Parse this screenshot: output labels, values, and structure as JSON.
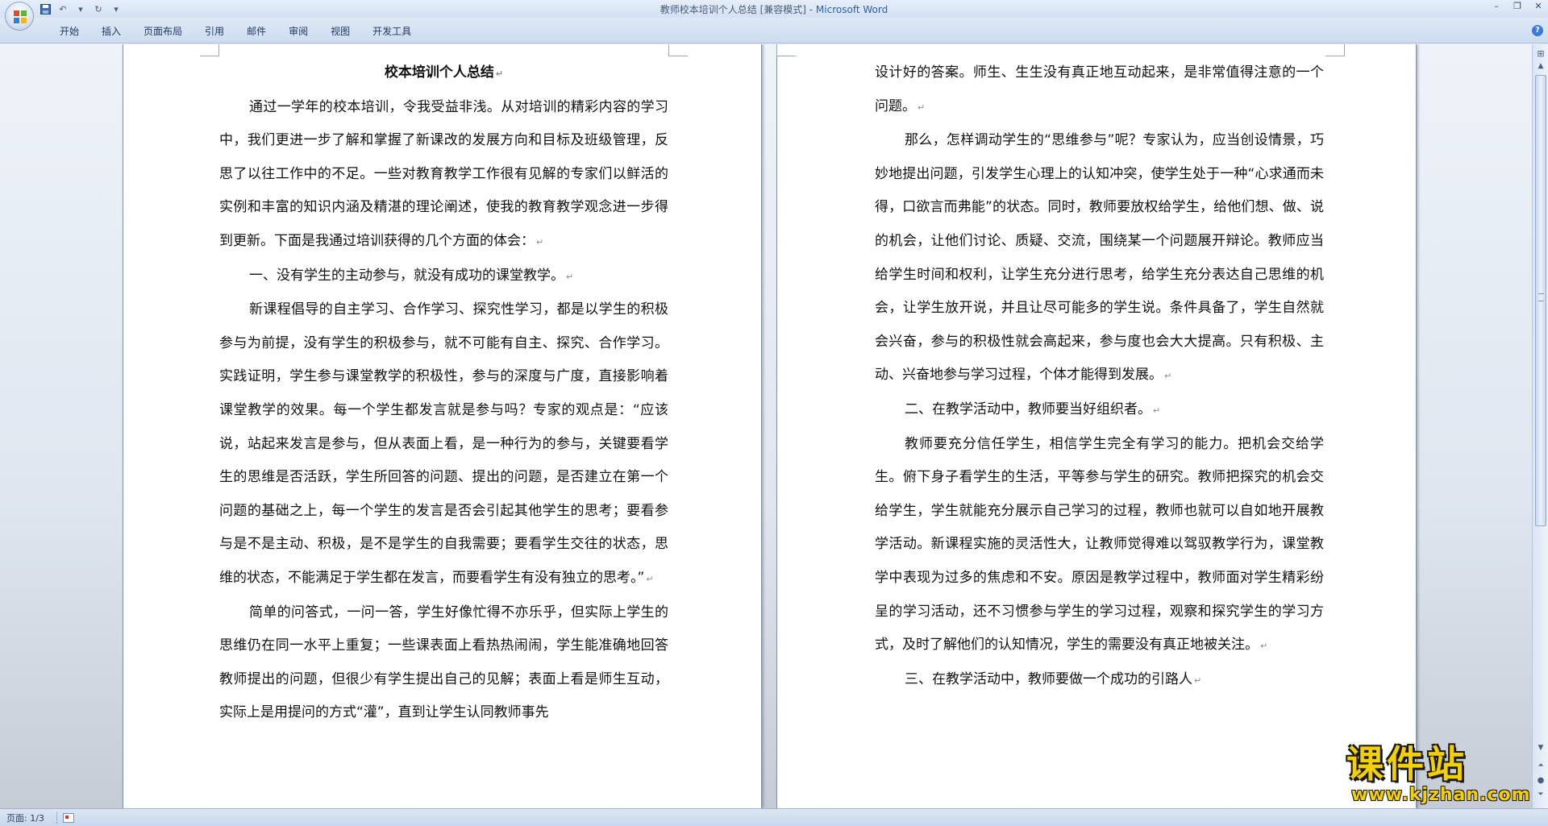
{
  "window": {
    "title_doc": "教师校本培训个人总结 [兼容模式] - ",
    "title_app": "Microsoft Word"
  },
  "ribbon": {
    "tabs": [
      "开始",
      "插入",
      "页面布局",
      "引用",
      "邮件",
      "审阅",
      "视图",
      "开发工具"
    ]
  },
  "document": {
    "title": "校本培训个人总结",
    "left_paragraphs": [
      "通过一学年的校本培训，令我受益非浅。从对培训的精彩内容的学习中，我们更进一步了解和掌握了新课改的发展方向和目标及班级管理，反思了以往工作中的不足。一些对教育教学工作很有见解的专家们以鲜活的实例和丰富的知识内涵及精湛的理论阐述，使我的教育教学观念进一步得到更新。下面是我通过培训获得的几个方面的体会：",
      "一、没有学生的主动参与，就没有成功的课堂教学。",
      "新课程倡导的自主学习、合作学习、探究性学习，都是以学生的积极参与为前提，没有学生的积极参与，就不可能有自主、探究、合作学习。实践证明，学生参与课堂教学的积极性，参与的深度与广度，直接影响着课堂教学的效果。每一个学生都发言就是参与吗？专家的观点是：“应该说，站起来发言是参与，但从表面上看，是一种行为的参与，关键要看学生的思维是否活跃，学生所回答的问题、提出的问题，是否建立在第一个问题的基础之上，每一个学生的发言是否会引起其他学生的思考；要看参与是不是主动、积极，是不是学生的自我需要；要看学生交往的状态，思维的状态，不能满足于学生都在发言，而要看学生有没有独立的思考。”",
      "简单的问答式，一问一答，学生好像忙得不亦乐乎，但实际上学生的思维仍在同一水平上重复；一些课表面上看热热闹闹，学生能准确地回答教师提出的问题，但很少有学生提出自己的见解；表面上看是师生互动，实际上是用提问的方式“灌”，直到让学生认同教师事先"
    ],
    "right_paragraphs": [
      "设计好的答案。师生、生生没有真正地互动起来，是非常值得注意的一个问题。",
      "那么，怎样调动学生的“思维参与”呢？专家认为，应当创设情景，巧妙地提出问题，引发学生心理上的认知冲突，使学生处于一种“心求通而未得，口欲言而弗能”的状态。同时，教师要放权给学生，给他们想、做、说的机会，让他们讨论、质疑、交流，围绕某一个问题展开辩论。教师应当给学生时间和权利，让学生充分进行思考，给学生充分表达自己思维的机会，让学生放开说，并且让尽可能多的学生说。条件具备了，学生自然就会兴奋，参与的积极性就会高起来，参与度也会大大提高。只有积极、主动、兴奋地参与学习过程，个体才能得到发展。",
      "二、在教学活动中，教师要当好组织者。",
      "教师要充分信任学生，相信学生完全有学习的能力。把机会交给学生。俯下身子看学生的生活，平等参与学生的研究。教师把探究的机会交给学生，学生就能充分展示自己学习的过程，教师也就可以自如地开展教学活动。新课程实施的灵活性大，让教师觉得难以驾驭教学行为，课堂教学中表现为过多的焦虑和不安。原因是教学过程中，教师面对学生精彩纷呈的学习活动，还不习惯参与学生的学习过程，观察和探究学生的学习方式，及时了解他们的认知情况，学生的需要没有真正地被关注。",
      "三、在教学活动中，教师要做一个成功的引路人"
    ],
    "pilcrow": "↵"
  },
  "statusbar": {
    "page_indicator": "页面: 1/3"
  },
  "watermark": {
    "big": "课件站",
    "url": "www.kjzhan.com"
  },
  "icons": {
    "office_button": "office-logo-icon",
    "save": "save-icon",
    "undo": "undo-icon",
    "redo": "redo-icon",
    "help": "help-icon"
  }
}
